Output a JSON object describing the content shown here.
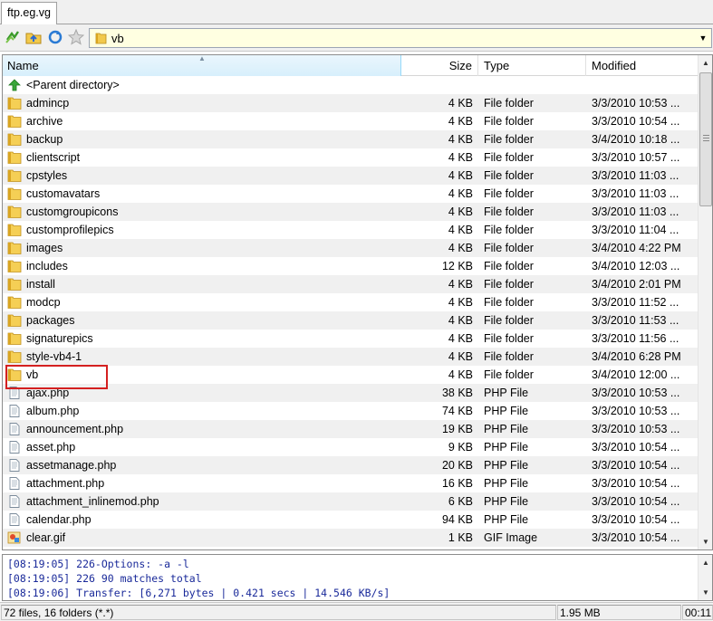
{
  "tab": {
    "label": "ftp.eg.vg"
  },
  "toolbar": {
    "buttons": [
      {
        "icon": "refresh-green-icon"
      },
      {
        "icon": "parent-folder-icon"
      },
      {
        "icon": "sync-icon"
      },
      {
        "icon": "favorite-star-icon"
      }
    ],
    "path": "vb"
  },
  "columns": {
    "name": "Name",
    "size": "Size",
    "type": "Type",
    "modified": "Modified"
  },
  "rows": [
    {
      "name": "<Parent directory>",
      "size": "",
      "type": "",
      "modified": "",
      "icon": "parent-directory-icon"
    },
    {
      "name": "admincp",
      "size": "4 KB",
      "type": "File folder",
      "modified": "3/3/2010 10:53 ...",
      "icon": "folder-icon"
    },
    {
      "name": "archive",
      "size": "4 KB",
      "type": "File folder",
      "modified": "3/3/2010 10:54 ...",
      "icon": "folder-icon"
    },
    {
      "name": "backup",
      "size": "4 KB",
      "type": "File folder",
      "modified": "3/4/2010 10:18 ...",
      "icon": "folder-icon"
    },
    {
      "name": "clientscript",
      "size": "4 KB",
      "type": "File folder",
      "modified": "3/3/2010 10:57 ...",
      "icon": "folder-icon"
    },
    {
      "name": "cpstyles",
      "size": "4 KB",
      "type": "File folder",
      "modified": "3/3/2010 11:03 ...",
      "icon": "folder-icon"
    },
    {
      "name": "customavatars",
      "size": "4 KB",
      "type": "File folder",
      "modified": "3/3/2010 11:03 ...",
      "icon": "folder-icon"
    },
    {
      "name": "customgroupicons",
      "size": "4 KB",
      "type": "File folder",
      "modified": "3/3/2010 11:03 ...",
      "icon": "folder-icon"
    },
    {
      "name": "customprofilepics",
      "size": "4 KB",
      "type": "File folder",
      "modified": "3/3/2010 11:04 ...",
      "icon": "folder-icon"
    },
    {
      "name": "images",
      "size": "4 KB",
      "type": "File folder",
      "modified": "3/4/2010 4:22 PM",
      "icon": "folder-icon"
    },
    {
      "name": "includes",
      "size": "12 KB",
      "type": "File folder",
      "modified": "3/4/2010 12:03 ...",
      "icon": "folder-icon"
    },
    {
      "name": "install",
      "size": "4 KB",
      "type": "File folder",
      "modified": "3/4/2010 2:01 PM",
      "icon": "folder-icon"
    },
    {
      "name": "modcp",
      "size": "4 KB",
      "type": "File folder",
      "modified": "3/3/2010 11:52 ...",
      "icon": "folder-icon"
    },
    {
      "name": "packages",
      "size": "4 KB",
      "type": "File folder",
      "modified": "3/3/2010 11:53 ...",
      "icon": "folder-icon"
    },
    {
      "name": "signaturepics",
      "size": "4 KB",
      "type": "File folder",
      "modified": "3/3/2010 11:56 ...",
      "icon": "folder-icon"
    },
    {
      "name": "style-vb4-1",
      "size": "4 KB",
      "type": "File folder",
      "modified": "3/4/2010 6:28 PM",
      "icon": "folder-icon"
    },
    {
      "name": "vb",
      "size": "4 KB",
      "type": "File folder",
      "modified": "3/4/2010 12:00 ...",
      "icon": "folder-icon"
    },
    {
      "name": "ajax.php",
      "size": "38 KB",
      "type": "PHP File",
      "modified": "3/3/2010 10:53 ...",
      "icon": "php-file-icon"
    },
    {
      "name": "album.php",
      "size": "74 KB",
      "type": "PHP File",
      "modified": "3/3/2010 10:53 ...",
      "icon": "php-file-icon"
    },
    {
      "name": "announcement.php",
      "size": "19 KB",
      "type": "PHP File",
      "modified": "3/3/2010 10:53 ...",
      "icon": "php-file-icon"
    },
    {
      "name": "asset.php",
      "size": "9 KB",
      "type": "PHP File",
      "modified": "3/3/2010 10:54 ...",
      "icon": "php-file-icon"
    },
    {
      "name": "assetmanage.php",
      "size": "20 KB",
      "type": "PHP File",
      "modified": "3/3/2010 10:54 ...",
      "icon": "php-file-icon"
    },
    {
      "name": "attachment.php",
      "size": "16 KB",
      "type": "PHP File",
      "modified": "3/3/2010 10:54 ...",
      "icon": "php-file-icon"
    },
    {
      "name": "attachment_inlinemod.php",
      "size": "6 KB",
      "type": "PHP File",
      "modified": "3/3/2010 10:54 ...",
      "icon": "php-file-icon"
    },
    {
      "name": "calendar.php",
      "size": "94 KB",
      "type": "PHP File",
      "modified": "3/3/2010 10:54 ...",
      "icon": "php-file-icon"
    },
    {
      "name": "clear.gif",
      "size": "1 KB",
      "type": "GIF Image",
      "modified": "3/3/2010 10:54 ...",
      "icon": "gif-image-icon"
    }
  ],
  "log": [
    "[08:19:05] 226-Options: -a -l",
    "[08:19:05] 226 90 matches total",
    "[08:19:06] Transfer: [6,271 bytes | 0.421 secs | 14.546 KB/s]"
  ],
  "status": {
    "summary": "72 files, 16 folders (*.*)",
    "size": "1.95 MB",
    "time": "00:11"
  },
  "colors": {
    "folder": "#f2c94c",
    "accent": "#96d9f9",
    "highlight": "#d42020",
    "log_text": "#1a2a9a",
    "path_bg": "#ffffe1"
  }
}
